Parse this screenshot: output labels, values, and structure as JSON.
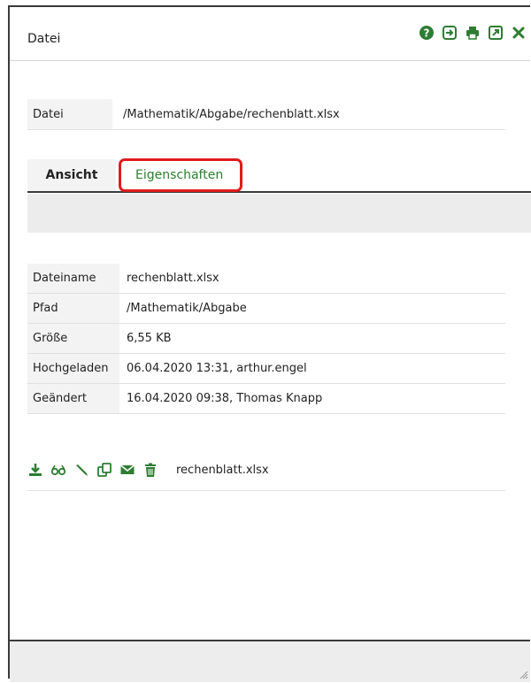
{
  "window": {
    "title": "Datei",
    "icons": [
      "help-icon",
      "login-icon",
      "print-icon",
      "external-link-icon",
      "close-icon"
    ]
  },
  "file": {
    "label": "Datei",
    "path": "/Mathematik/Abgabe/rechenblatt.xlsx"
  },
  "tabs": {
    "view": "Ansicht",
    "properties": "Eigenschaften"
  },
  "properties": {
    "rows": [
      {
        "label": "Dateiname",
        "value": "rechenblatt.xlsx"
      },
      {
        "label": "Pfad",
        "value": "/Mathematik/Abgabe"
      },
      {
        "label": "Größe",
        "value": "6,55 KB"
      },
      {
        "label": "Hochgeladen",
        "value": "06.04.2020 13:31, arthur.engel"
      },
      {
        "label": "Geändert",
        "value": "16.04.2020 09:38, Thomas Knapp"
      }
    ]
  },
  "actions": {
    "icons": [
      "download-icon",
      "preview-icon",
      "edit-icon",
      "copy-icon",
      "email-icon",
      "delete-icon"
    ],
    "filename": "rechenblatt.xlsx"
  },
  "colors": {
    "accent": "#2e7d32",
    "highlight": "#e01b1b"
  }
}
